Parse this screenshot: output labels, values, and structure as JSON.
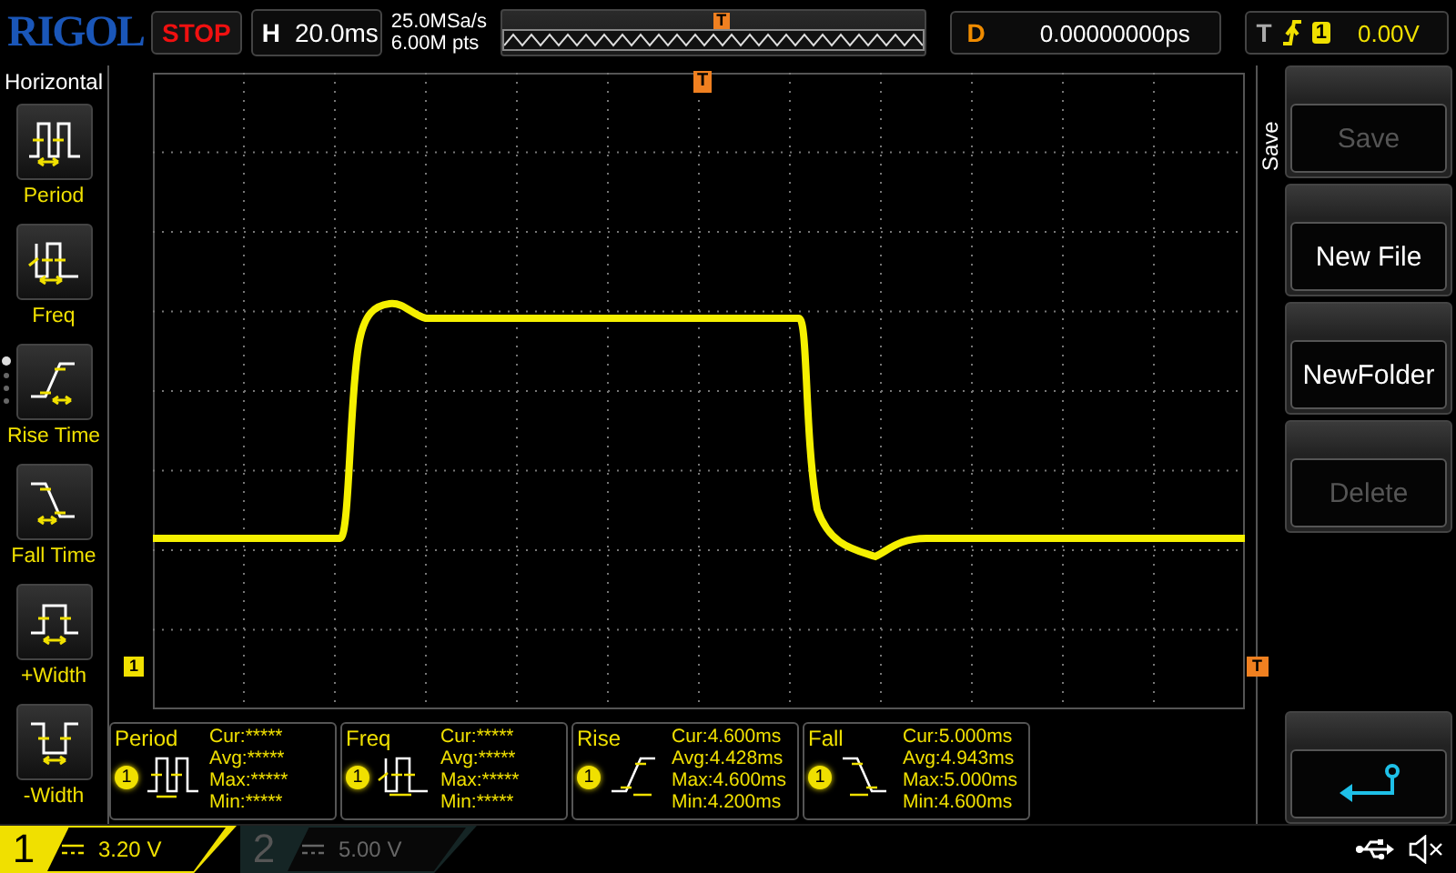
{
  "top_bar": {
    "logo": "RIGOL",
    "run_state": "STOP",
    "timebase": {
      "label": "H",
      "value": "20.0ms"
    },
    "sample_rate": "25.0MSa/s",
    "memory_depth": "6.00M pts",
    "memory_trigger_marker": "T",
    "delay": {
      "label": "D",
      "value": "0.00000000ps"
    },
    "trigger": {
      "label": "T",
      "source": "1",
      "level": "0.00V"
    }
  },
  "sidebar": {
    "title": "Horizontal",
    "items": [
      {
        "label": "Period",
        "kind": "period"
      },
      {
        "label": "Freq",
        "kind": "freq"
      },
      {
        "label": "Rise Time",
        "kind": "rise"
      },
      {
        "label": "Fall Time",
        "kind": "fall"
      },
      {
        "label": "+Width",
        "kind": "pwidth"
      },
      {
        "label": "-Width",
        "kind": "nwidth"
      }
    ],
    "pages": [
      {
        "selected": true
      },
      {
        "selected": false
      },
      {
        "selected": false
      },
      {
        "selected": false
      }
    ]
  },
  "screen": {
    "trigger_position_marker": "T",
    "channel_marker": "1",
    "trigger_level_marker": "T"
  },
  "measurements": [
    {
      "kind": "period",
      "name": "Period",
      "source": "1",
      "rows": [
        {
          "label": "Cur:",
          "value": "*****"
        },
        {
          "label": "Avg:",
          "value": "*****"
        },
        {
          "label": "Max:",
          "value": "*****"
        },
        {
          "label": "Min:",
          "value": "*****"
        }
      ]
    },
    {
      "kind": "freq",
      "name": "Freq",
      "source": "1",
      "rows": [
        {
          "label": "Cur:",
          "value": "*****"
        },
        {
          "label": "Avg:",
          "value": "*****"
        },
        {
          "label": "Max:",
          "value": "*****"
        },
        {
          "label": "Min:",
          "value": "*****"
        }
      ]
    },
    {
      "kind": "rise",
      "name": "Rise",
      "source": "1",
      "rows": [
        {
          "label": "Cur:",
          "value": "4.600ms"
        },
        {
          "label": "Avg:",
          "value": "4.428ms"
        },
        {
          "label": "Max:",
          "value": "4.600ms"
        },
        {
          "label": "Min:",
          "value": "4.200ms"
        }
      ]
    },
    {
      "kind": "fall",
      "name": "Fall",
      "source": "1",
      "rows": [
        {
          "label": "Cur:",
          "value": "5.000ms"
        },
        {
          "label": "Avg:",
          "value": "4.943ms"
        },
        {
          "label": "Max:",
          "value": "5.000ms"
        },
        {
          "label": "Min:",
          "value": "4.600ms"
        }
      ]
    }
  ],
  "menu": {
    "title": "Save",
    "buttons": [
      {
        "label": "Save",
        "disabled": true
      },
      {
        "label": "New File",
        "disabled": false
      },
      {
        "label": "NewFolder",
        "disabled": false
      },
      {
        "label": "Delete",
        "disabled": true
      }
    ]
  },
  "status_bar": {
    "channels": [
      {
        "number": "1",
        "scale": "3.20 V",
        "on": true
      },
      {
        "number": "2",
        "scale": "5.00 V",
        "on": false
      }
    ]
  }
}
